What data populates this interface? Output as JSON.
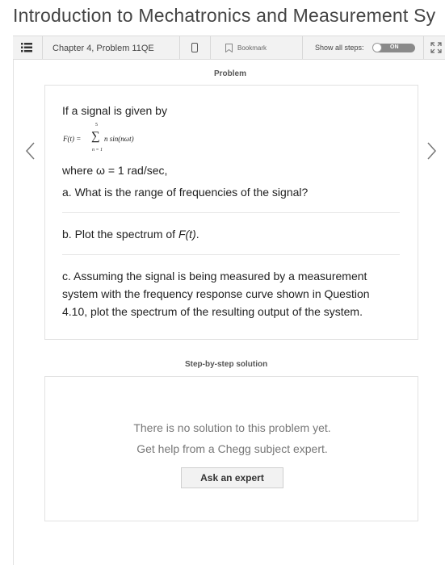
{
  "book_title": "Introduction to Mechatronics and Measurement Sy",
  "toolbar": {
    "chapter_label": "Chapter 4, Problem 11QE",
    "bookmark_label": "Bookmark",
    "show_steps_label": "Show all steps:",
    "toggle_text": "ON"
  },
  "problem": {
    "section_label": "Problem",
    "intro": "If a signal is given by",
    "formula": {
      "lhs": "F(t) =",
      "upper_limit": "5",
      "sigma": "∑",
      "summand": "n sin(nωt)",
      "lower_limit": "n = 1"
    },
    "where": "where ω = 1 rad/sec,",
    "part_a": "a. What is the range of frequencies of the signal?",
    "part_b_prefix": "b. Plot the spectrum of ",
    "part_b_func": "F(t)",
    "part_b_suffix": ".",
    "part_c": "c. Assuming the signal is being measured by a measurement system with the frequency response curve shown in Question 4.10, plot the spectrum of the resulting output of the system."
  },
  "solution": {
    "section_label": "Step-by-step solution",
    "line1": "There is no solution to this problem yet.",
    "line2": "Get help from a Chegg subject expert.",
    "ask_label": "Ask an expert"
  }
}
